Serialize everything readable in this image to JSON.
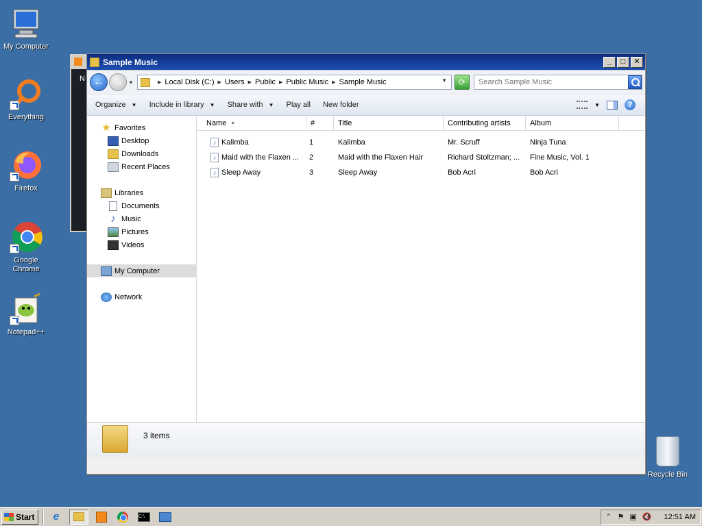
{
  "desktop": {
    "icons": [
      {
        "label": "My Computer",
        "icon": "computer-icon"
      },
      {
        "label": "Everything",
        "icon": "everything-search-icon"
      },
      {
        "label": "Firefox",
        "icon": "firefox-icon"
      },
      {
        "label": "Google Chrome",
        "icon": "chrome-icon"
      },
      {
        "label": "Notepad++",
        "icon": "notepadpp-icon"
      },
      {
        "label": "Recycle Bin",
        "icon": "recycle-bin-icon"
      }
    ]
  },
  "background_window": {
    "partial_text": "N"
  },
  "window": {
    "title": "Sample Music",
    "breadcrumbs": [
      "Local Disk (C:)",
      "Users",
      "Public",
      "Public Music",
      "Sample Music"
    ],
    "search_placeholder": "Search Sample Music",
    "toolbar": {
      "organize": "Organize",
      "include_in_library": "Include in library",
      "share_with": "Share with",
      "play_all": "Play all",
      "new_folder": "New folder"
    },
    "nav": {
      "favorites": "Favorites",
      "desktop": "Desktop",
      "downloads": "Downloads",
      "recent_places": "Recent Places",
      "libraries": "Libraries",
      "documents": "Documents",
      "music": "Music",
      "pictures": "Pictures",
      "videos": "Videos",
      "my_computer": "My Computer",
      "network": "Network"
    },
    "columns": {
      "name": "Name",
      "number": "#",
      "title": "Title",
      "artists": "Contributing artists",
      "album": "Album"
    },
    "files": [
      {
        "name": "Kalimba",
        "number": "1",
        "title": "Kalimba",
        "artists": "Mr. Scruff",
        "album": "Ninja Tuna"
      },
      {
        "name": "Maid with the Flaxen ...",
        "number": "2",
        "title": "Maid with the Flaxen Hair",
        "artists": "Richard Stoltzman; ...",
        "album": "Fine Music, Vol. 1"
      },
      {
        "name": "Sleep Away",
        "number": "3",
        "title": "Sleep Away",
        "artists": "Bob Acri",
        "album": "Bob Acri"
      }
    ],
    "status": {
      "item_count": "3 items"
    }
  },
  "taskbar": {
    "start_label": "Start",
    "clock": "12:51 AM"
  }
}
